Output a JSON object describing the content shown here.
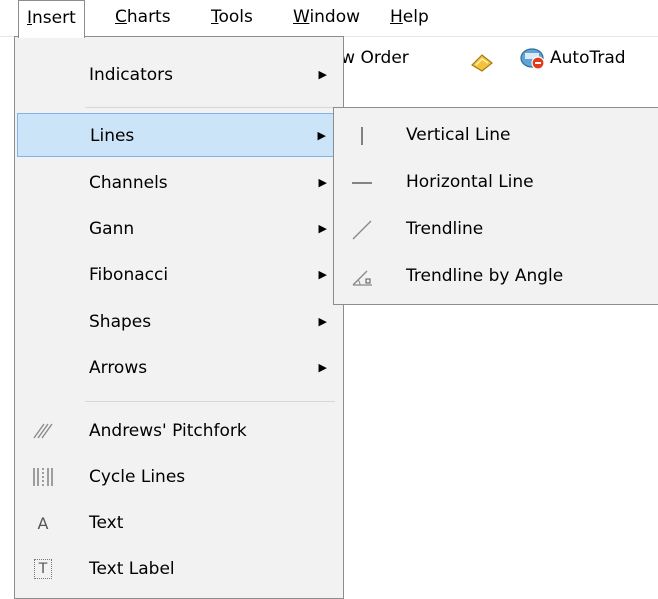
{
  "menubar": {
    "items": [
      {
        "label": "Insert",
        "active": true
      },
      {
        "label": "Charts"
      },
      {
        "label": "Tools"
      },
      {
        "label": "Window"
      },
      {
        "label": "Help"
      }
    ]
  },
  "toolbar": {
    "new_order": "New Order",
    "autotrading": "AutoTrad"
  },
  "insert_menu": {
    "items": [
      {
        "label": "Indicators",
        "submenu": true
      },
      {
        "label": "Lines",
        "submenu": true,
        "highlighted": true
      },
      {
        "label": "Channels",
        "submenu": true
      },
      {
        "label": "Gann",
        "submenu": true
      },
      {
        "label": "Fibonacci",
        "submenu": true
      },
      {
        "label": "Shapes",
        "submenu": true
      },
      {
        "label": "Arrows",
        "submenu": true
      },
      {
        "label": "Andrews' Pitchfork",
        "icon": "pitchfork-icon"
      },
      {
        "label": "Cycle Lines",
        "icon": "cycle-lines-icon"
      },
      {
        "label": "Text",
        "icon": "text-icon"
      },
      {
        "label": "Text Label",
        "icon": "text-label-icon"
      }
    ]
  },
  "lines_submenu": {
    "items": [
      {
        "label": "Vertical Line",
        "icon": "vertical-line-icon"
      },
      {
        "label": "Horizontal Line",
        "icon": "horizontal-line-icon"
      },
      {
        "label": "Trendline",
        "icon": "trendline-icon"
      },
      {
        "label": "Trendline by Angle",
        "icon": "trendline-angle-icon"
      }
    ]
  },
  "icons": {
    "text_glyph": "A",
    "text_label_glyph": "T"
  }
}
